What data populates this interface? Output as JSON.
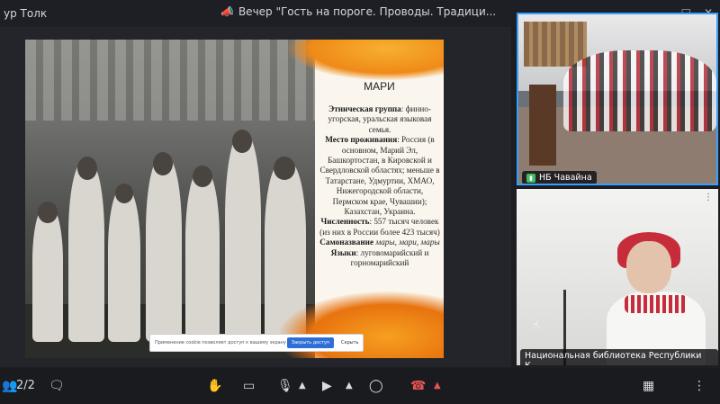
{
  "window": {
    "left_title": "ур Толк",
    "title": "Вечер \"Гость на пороге. Проводы. Традици...",
    "controls": [
      "—",
      "□",
      "✕"
    ]
  },
  "slide": {
    "heading": "МАРИ",
    "fields": [
      {
        "label": "Этническая группа",
        "value": ": финно-угорская, уральская языковая семья."
      },
      {
        "label": "Место проживания",
        "value": ": Россия (в основном, Марий Эл, Башкортостан, в Кировской и Свердловской областях; меньше в Татарстане, Удмуртии, ХМАО, Нижегородской области, Пермском крае, Чувашии); Казахстан, Украина."
      },
      {
        "label": "Численность",
        "value": ": 557 тысяч человек (из них в России более 423 тысяч)"
      },
      {
        "label": "Самоназвание",
        "value": " мары, мари, мары"
      },
      {
        "label": "Языки",
        "value": ": луговомарийский и горномарийский"
      }
    ],
    "cookie": {
      "text": "Применение cookie позволяет доступ к вашему экрану",
      "button": "Закрыть доступ",
      "close": "Скрыть"
    }
  },
  "participants": [
    {
      "name": "НБ Чавайна",
      "active": true
    },
    {
      "name": "Национальная библиотека Республики К..."
    }
  ],
  "toolbar": {
    "participants_count": "2/2",
    "items": [
      "chat",
      "raise-hand",
      "screen-share",
      "microphone",
      "camera",
      "record",
      "end-call",
      "layout",
      "more"
    ]
  },
  "colors": {
    "accent": "#3aa0ff",
    "danger": "#e85454",
    "mic_green": "#3fbf5f"
  }
}
